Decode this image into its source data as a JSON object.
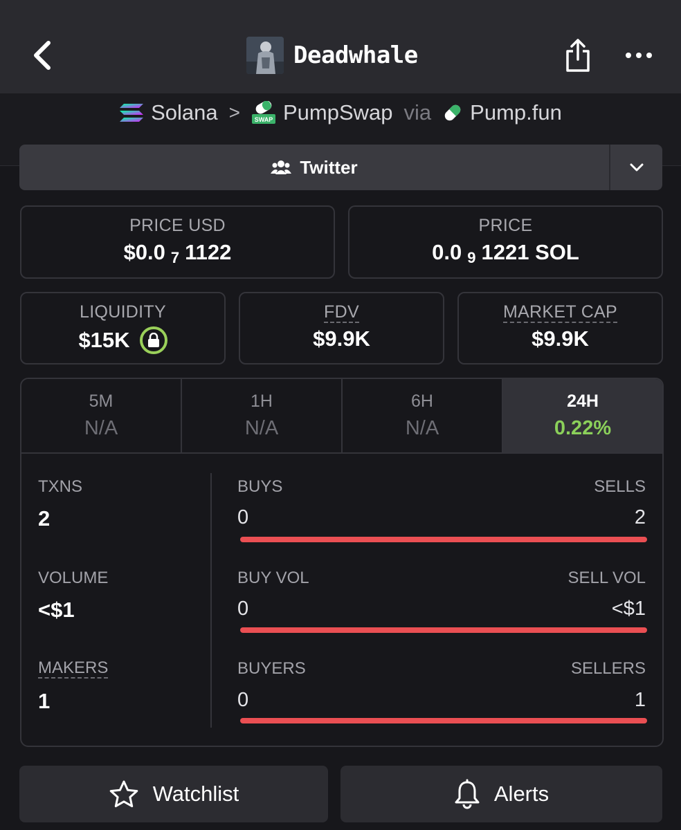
{
  "header": {
    "title": "Deadwhale",
    "back_icon": "chevron-left-icon",
    "share_icon": "share-icon",
    "more_icon": "more-horizontal-icon"
  },
  "breadcrumb": {
    "chain": "Solana",
    "separator": ">",
    "dex": "PumpSwap",
    "dex_badge": "SWAP",
    "via": "via",
    "launchpad": "Pump.fun"
  },
  "socials": {
    "label": "Twitter",
    "icon": "users-icon",
    "caret_icon": "chevron-down-icon"
  },
  "prices": {
    "usd": {
      "label": "PRICE USD",
      "prefix": "$0.0",
      "zeros": "7",
      "digits": "1122"
    },
    "native": {
      "label": "PRICE",
      "prefix": "0.0",
      "zeros": "9",
      "digits": "1221 SOL"
    }
  },
  "stats_row": {
    "liquidity": {
      "label": "LIQUIDITY",
      "value": "$15K"
    },
    "fdv": {
      "label": "FDV",
      "value": "$9.9K"
    },
    "market_cap": {
      "label": "MARKET CAP",
      "value": "$9.9K"
    }
  },
  "timeframes": [
    {
      "label": "5M",
      "value": "N/A",
      "active": false
    },
    {
      "label": "1H",
      "value": "N/A",
      "active": false
    },
    {
      "label": "6H",
      "value": "N/A",
      "active": false
    },
    {
      "label": "24H",
      "value": "0.22%",
      "active": true
    }
  ],
  "metrics": {
    "txns": {
      "label": "TXNS",
      "value": "2"
    },
    "volume": {
      "label": "VOLUME",
      "value": "<$1"
    },
    "makers": {
      "label": "MAKERS",
      "value": "1"
    }
  },
  "splits": {
    "txns": {
      "left_label": "BUYS",
      "left_value": "0",
      "right_label": "SELLS",
      "right_value": "2",
      "sell_fraction": 1.0
    },
    "volume": {
      "left_label": "BUY VOL",
      "left_value": "0",
      "right_label": "SELL VOL",
      "right_value": "<$1",
      "sell_fraction": 1.0
    },
    "makers": {
      "left_label": "BUYERS",
      "left_value": "0",
      "right_label": "SELLERS",
      "right_value": "1",
      "sell_fraction": 1.0
    }
  },
  "actions": {
    "watchlist": "Watchlist",
    "alerts": "Alerts"
  },
  "colors": {
    "positive": "#8bd05a",
    "sell_bar": "#ea4f53",
    "background": "#17171b"
  }
}
